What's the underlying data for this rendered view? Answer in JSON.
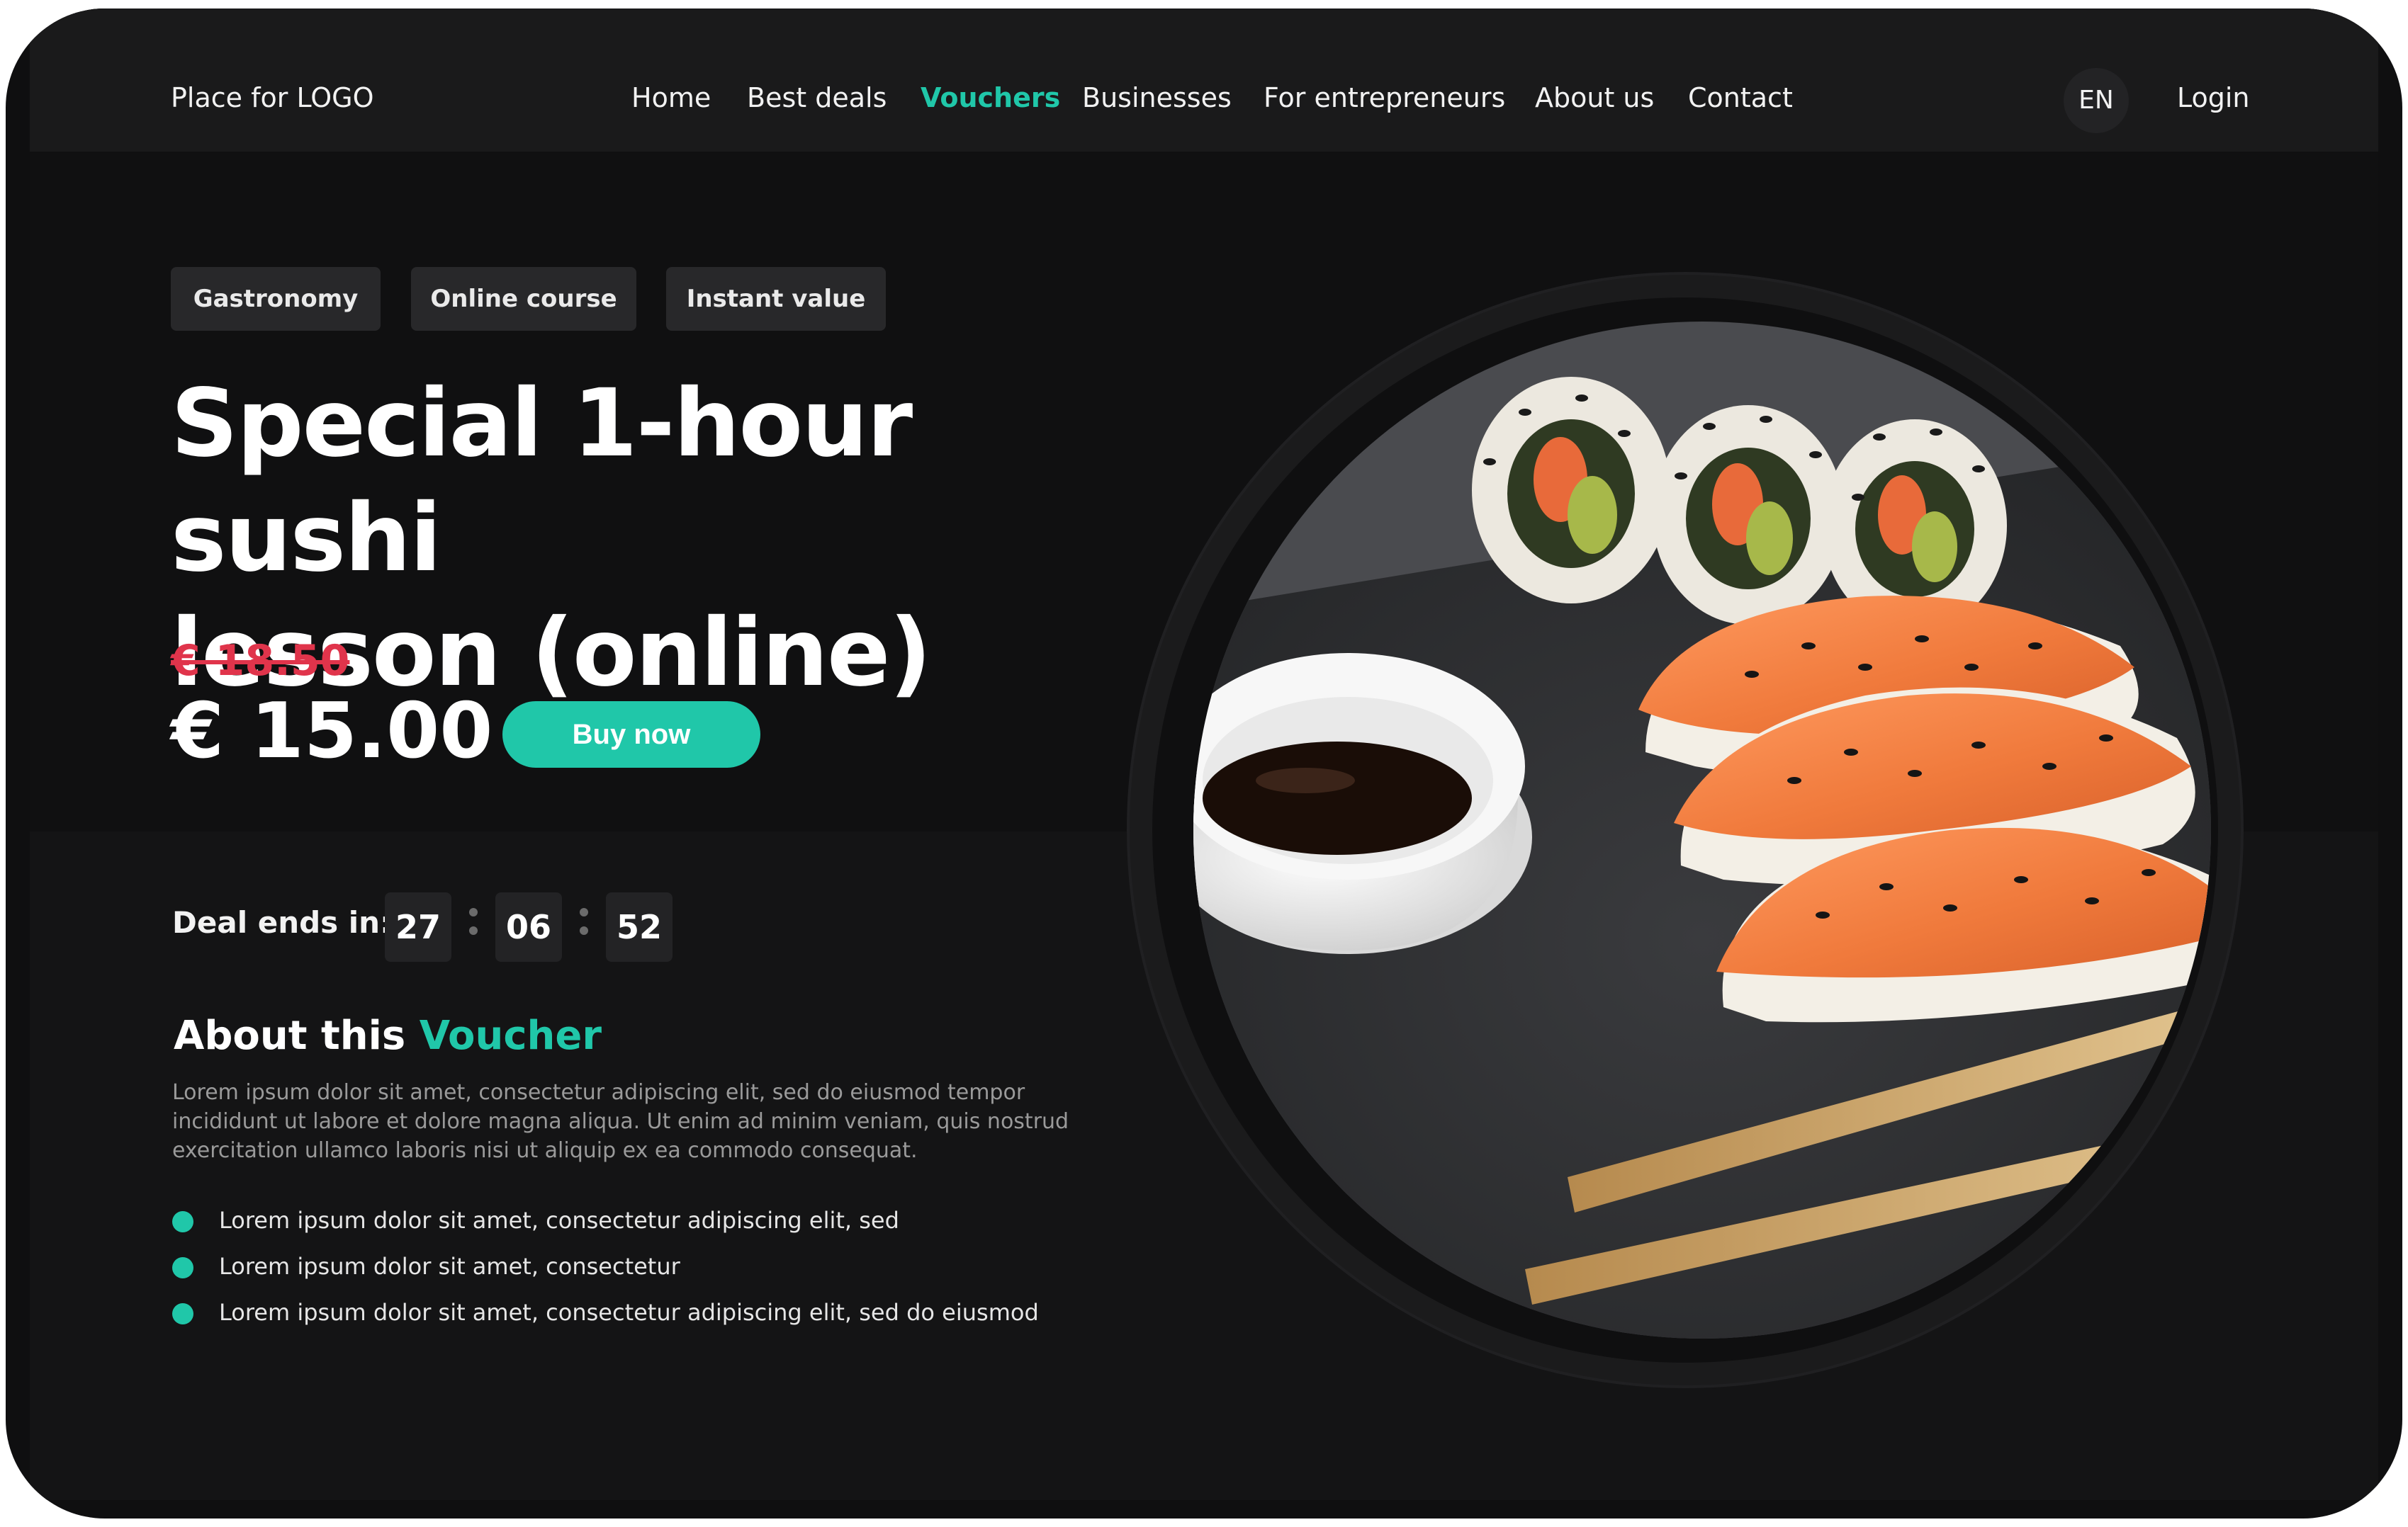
{
  "header": {
    "logo": "Place for LOGO",
    "nav": [
      "Home",
      "Best deals",
      "Vouchers",
      "Businesses",
      "For entrepreneurs",
      "About us",
      "Contact"
    ],
    "active_nav": "Vouchers",
    "lang": "EN",
    "login": "Login"
  },
  "hero": {
    "tags": [
      "Gastronomy",
      "Online course",
      "Instant value"
    ],
    "title_line1": "Special 1-hour sushi",
    "title_line2": "lesson (online)",
    "old_price": "€ 18.50",
    "price": "€ 15.00",
    "buy_label": "Buy now"
  },
  "countdown": {
    "label": "Deal ends in:",
    "hours": "27",
    "minutes": "06",
    "seconds": "52"
  },
  "about": {
    "heading_prefix": "About this",
    "heading_accent": "Voucher",
    "paragraph": "Lorem ipsum dolor sit amet, consectetur adipiscing elit, sed do eiusmod tempor incididunt ut labore et dolore magna aliqua. Ut enim ad minim veniam, quis nostrud exercitation ullamco laboris nisi ut aliquip ex ea commodo consequat.",
    "bullets": [
      "Lorem ipsum dolor sit amet, consectetur adipiscing elit, sed",
      "Lorem ipsum dolor sit amet, consectetur",
      "Lorem ipsum dolor sit amet, consectetur adipiscing elit, sed do eiusmod"
    ]
  },
  "colors": {
    "accent": "#20c7a9",
    "old_price": "#e0344b",
    "background": "#141415"
  },
  "image": {
    "alt": "sushi-plate-photo"
  }
}
